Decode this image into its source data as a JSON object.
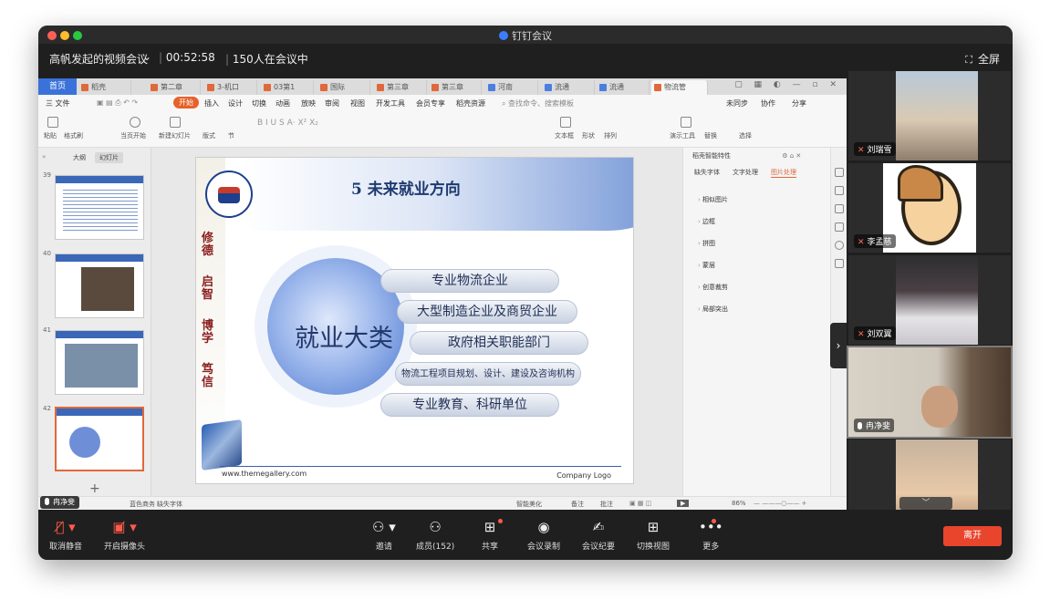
{
  "app": {
    "title": "钉钉会议"
  },
  "meeting": {
    "name": "高帆发起的视频会议",
    "timer": "00:52:58",
    "participants_text": "150人在会议中",
    "fullscreen_label": "全屏"
  },
  "wps": {
    "tabs": [
      "首页",
      "稻壳",
      "第二章",
      "3-机口",
      "03第1",
      "国际",
      "第三章",
      "第三章",
      "河南",
      "流通",
      "流通",
      "物流管"
    ],
    "menu": [
      "三 文件",
      "开始",
      "插入",
      "设计",
      "切换",
      "动画",
      "放映",
      "审阅",
      "视图",
      "开发工具",
      "会员专享",
      "稻壳资源"
    ],
    "search_placeholder": "查找命令、搜索模板",
    "right_actions": [
      "未同步",
      "协作",
      "分享"
    ],
    "toolbar_items": [
      "粘贴",
      "格式刷",
      "当页开始",
      "新建幻灯片",
      "版式",
      "节",
      "文本框",
      "形状",
      "排列",
      "演示工具",
      "替换",
      "选择"
    ],
    "pane_tabs": [
      "大纲",
      "幻灯片"
    ],
    "slide_numbers": [
      "39",
      "40",
      "41",
      "42"
    ],
    "add_slide": "+"
  },
  "slide": {
    "title": "5  未来就业方向",
    "motto": [
      "修德",
      "启智",
      "博学",
      "笃信"
    ],
    "center_label": "就业大类",
    "pills": [
      "专业物流企业",
      "大型制造企业及商贸企业",
      "政府相关职能部门",
      "物流工程项目规划、设计、建设及咨询机构",
      "专业教育、科研单位"
    ],
    "footer_left": "www.themegallery.com",
    "footer_right": "Company Logo"
  },
  "right_panel": {
    "header": "稻壳智能特性",
    "tabs": [
      "缺失字体",
      "文字处理",
      "图片处理"
    ],
    "items": [
      "相似图片",
      "边框",
      "拼图",
      "蒙层",
      "创意裁剪",
      "局部突出"
    ]
  },
  "statusbar": {
    "items": [
      "智能美化",
      "备注",
      "批注"
    ],
    "zoom": "86%",
    "theme": "蓝色商务",
    "font_missing": "缺失字体"
  },
  "active_speaker": "冉净斐",
  "gallery": {
    "participants": [
      {
        "name": "刘瑞雪",
        "muted": true
      },
      {
        "name": "李孟慈",
        "muted": true
      },
      {
        "name": "刘双翼",
        "muted": true
      },
      {
        "name": "冉净斐",
        "muted": false
      },
      {
        "name": "",
        "muted": true
      }
    ]
  },
  "bottombar": {
    "buttons": [
      {
        "label": "取消静音",
        "icon": "mic-muted-icon"
      },
      {
        "label": "开启摄像头",
        "icon": "camera-off-icon"
      },
      {
        "label": "邀请",
        "icon": "invite-icon"
      },
      {
        "label": "成员(152)",
        "icon": "members-icon"
      },
      {
        "label": "共享",
        "icon": "share-screen-icon"
      },
      {
        "label": "会议录制",
        "icon": "record-icon"
      },
      {
        "label": "会议纪要",
        "icon": "notes-icon"
      },
      {
        "label": "切换视图",
        "icon": "grid-view-icon"
      },
      {
        "label": "更多",
        "icon": "more-icon"
      }
    ],
    "leave_label": "离开"
  },
  "colors": {
    "leave": "#e8452c",
    "wps_accent": "#e0683a",
    "muted": "#ff5a4a"
  }
}
